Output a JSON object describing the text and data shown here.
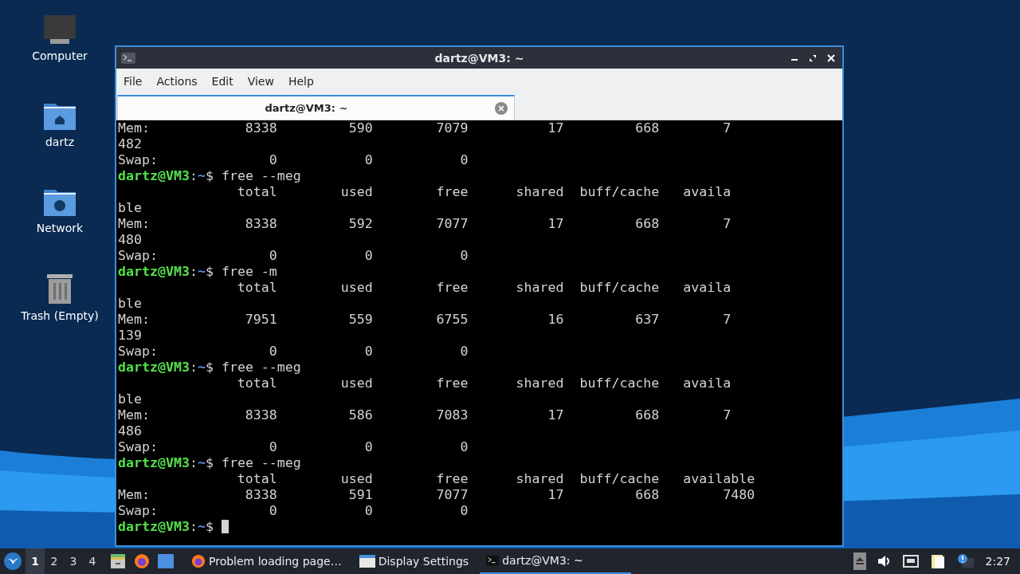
{
  "desktop_icons": [
    {
      "kind": "computer",
      "label": "Computer"
    },
    {
      "kind": "home-folder",
      "label": "dartz"
    },
    {
      "kind": "network-folder",
      "label": "Network"
    },
    {
      "kind": "trash",
      "label": "Trash (Empty)"
    }
  ],
  "window": {
    "title": "dartz@VM3: ~",
    "menu": [
      "File",
      "Actions",
      "Edit",
      "View",
      "Help"
    ],
    "tabs": [
      {
        "label": "dartz@VM3: ~",
        "selected": true
      }
    ],
    "terminal": {
      "lines": [
        {
          "kind": "output",
          "text": "Mem:            8338         590        7079          17         668        7"
        },
        {
          "kind": "output",
          "text": "482"
        },
        {
          "kind": "output",
          "text": "Swap:              0           0           0"
        },
        {
          "kind": "prompt",
          "user": "dartz@VM3",
          "separator": ":",
          "path": "~",
          "symbol": "$",
          "command": "free --meg"
        },
        {
          "kind": "output",
          "text": "               total        used        free      shared  buff/cache   availa"
        },
        {
          "kind": "output",
          "text": "ble"
        },
        {
          "kind": "output",
          "text": "Mem:            8338         592        7077          17         668        7"
        },
        {
          "kind": "output",
          "text": "480"
        },
        {
          "kind": "output",
          "text": "Swap:              0           0           0"
        },
        {
          "kind": "prompt",
          "user": "dartz@VM3",
          "separator": ":",
          "path": "~",
          "symbol": "$",
          "command": "free -m"
        },
        {
          "kind": "output",
          "text": "               total        used        free      shared  buff/cache   availa"
        },
        {
          "kind": "output",
          "text": "ble"
        },
        {
          "kind": "output",
          "text": "Mem:            7951         559        6755          16         637        7"
        },
        {
          "kind": "output",
          "text": "139"
        },
        {
          "kind": "output",
          "text": "Swap:              0           0           0"
        },
        {
          "kind": "prompt",
          "user": "dartz@VM3",
          "separator": ":",
          "path": "~",
          "symbol": "$",
          "command": "free --meg"
        },
        {
          "kind": "output",
          "text": "               total        used        free      shared  buff/cache   availa"
        },
        {
          "kind": "output",
          "text": "ble"
        },
        {
          "kind": "output",
          "text": "Mem:            8338         586        7083          17         668        7"
        },
        {
          "kind": "output",
          "text": "486"
        },
        {
          "kind": "output",
          "text": "Swap:              0           0           0"
        },
        {
          "kind": "prompt",
          "user": "dartz@VM3",
          "separator": ":",
          "path": "~",
          "symbol": "$",
          "command": "free --meg"
        },
        {
          "kind": "output",
          "text": "               total        used        free      shared  buff/cache   available"
        },
        {
          "kind": "output",
          "text": "Mem:            8338         591        7077          17         668        7480"
        },
        {
          "kind": "output",
          "text": "Swap:              0           0           0"
        },
        {
          "kind": "prompt",
          "user": "dartz@VM3",
          "separator": ":",
          "path": "~",
          "symbol": "$",
          "cursor": true
        }
      ]
    }
  },
  "taskbar": {
    "workspaces": [
      {
        "label": "1",
        "selected": true
      },
      {
        "label": "2",
        "selected": false
      },
      {
        "label": "3",
        "selected": false
      },
      {
        "label": "4",
        "selected": false
      }
    ],
    "launchers": [
      {
        "kind": "file-manager"
      },
      {
        "kind": "browser"
      },
      {
        "kind": "desktop"
      }
    ],
    "tasks": [
      {
        "kind": "browser",
        "label": "Problem loading page…",
        "selected": false
      },
      {
        "kind": "window",
        "label": "Display Settings",
        "selected": false
      },
      {
        "kind": "terminal",
        "label": "dartz@VM3: ~",
        "selected": true
      }
    ],
    "clock": "2:27"
  }
}
